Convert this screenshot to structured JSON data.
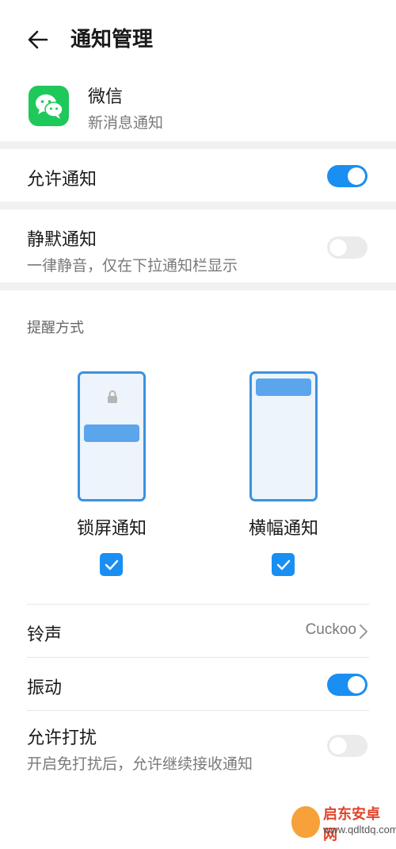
{
  "header": {
    "title": "通知管理"
  },
  "app": {
    "name": "微信",
    "subtitle": "新消息通知"
  },
  "allow_notifications": {
    "label": "允许通知",
    "enabled": true
  },
  "silent": {
    "label": "静默通知",
    "description": "一律静音，仅在下拉通知栏显示",
    "enabled": false
  },
  "reminder": {
    "section_label": "提醒方式",
    "options": [
      {
        "label": "锁屏通知",
        "checked": true
      },
      {
        "label": "横幅通知",
        "checked": true
      }
    ]
  },
  "ringtone": {
    "label": "铃声",
    "value": "Cuckoo"
  },
  "vibrate": {
    "label": "振动",
    "enabled": true
  },
  "dnd": {
    "label": "允许打扰",
    "description": "开启免打扰后，允许继续接收通知",
    "enabled": false
  },
  "watermark": {
    "title": "启东安卓网",
    "url": "www.qdltdq.com"
  },
  "colors": {
    "accent": "#1a8ff2",
    "wechat_green": "#1fc85a",
    "divider": "#f1f1f1"
  }
}
